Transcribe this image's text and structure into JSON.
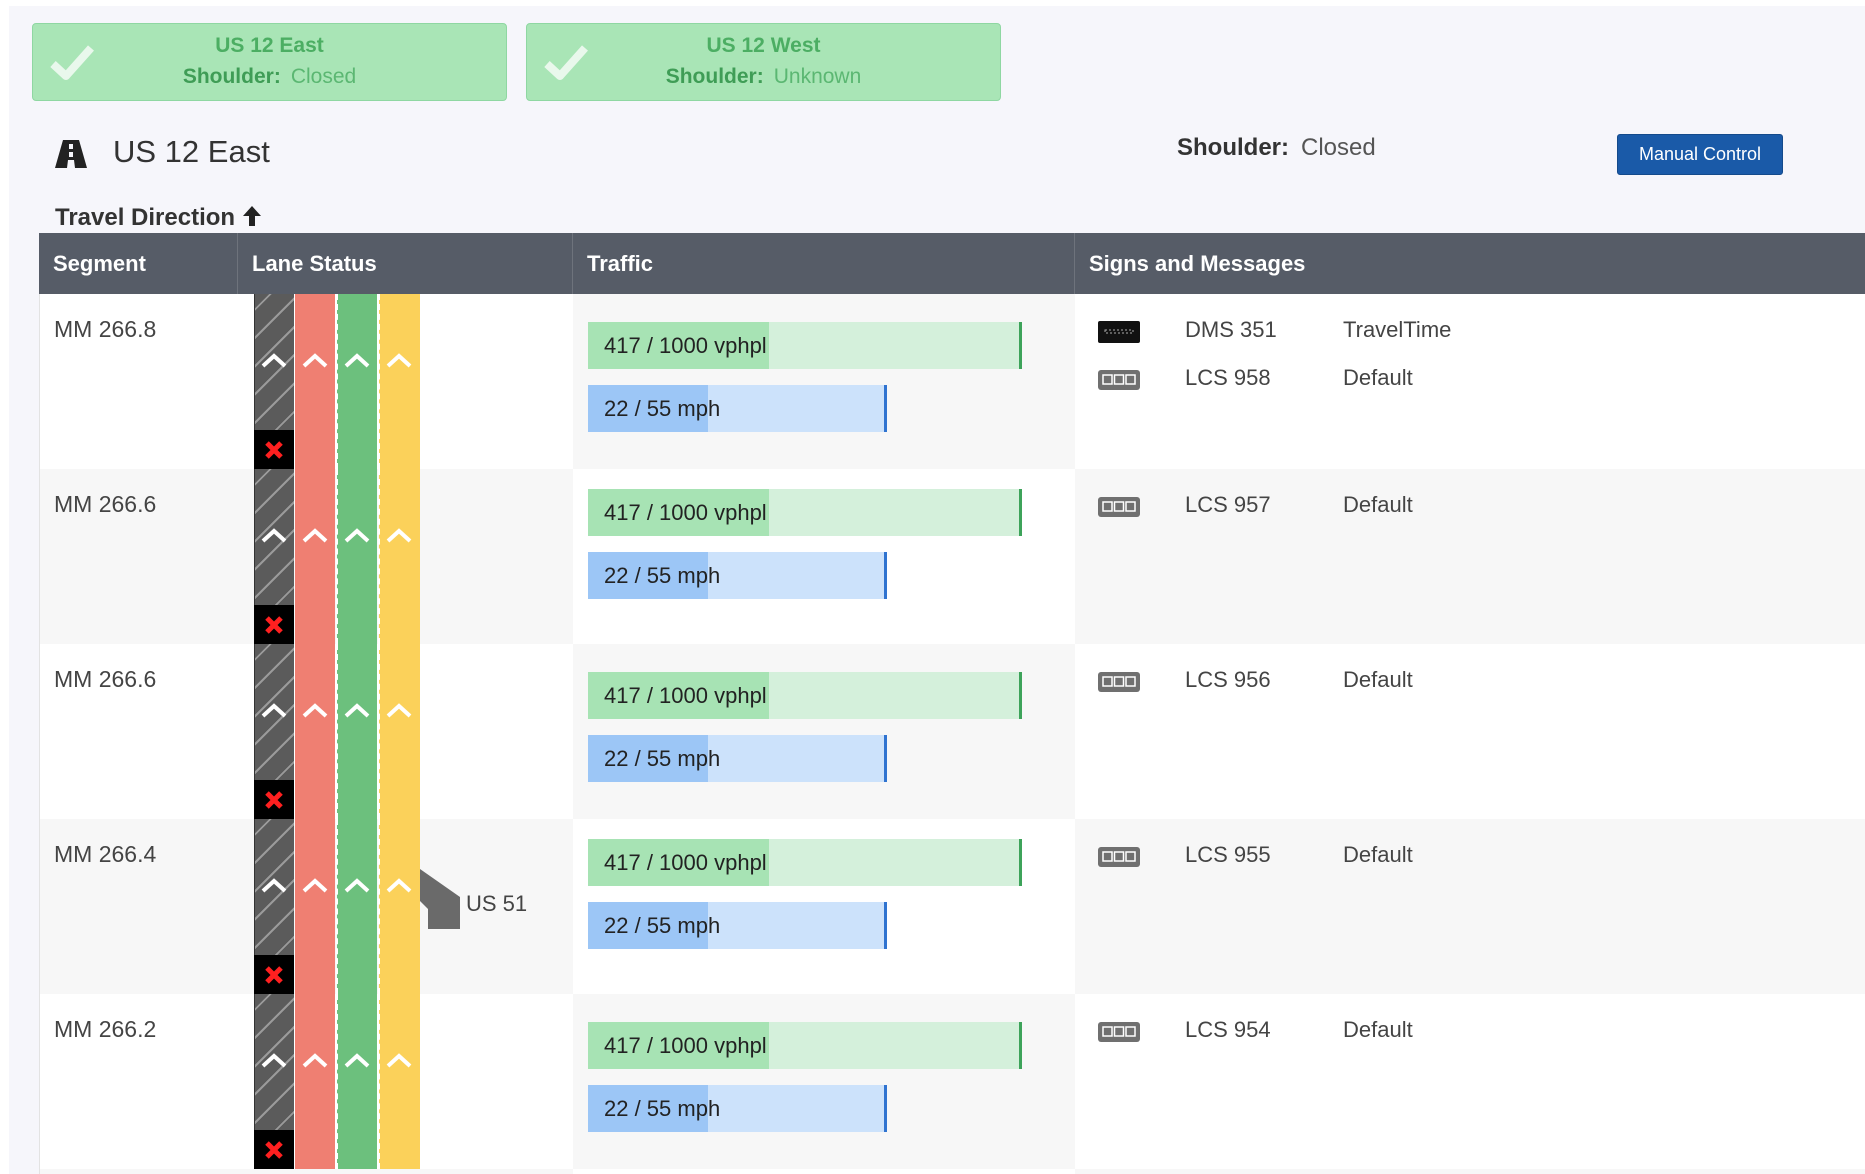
{
  "status_cards": [
    {
      "title": "US 12 East",
      "shoulder_label": "Shoulder:",
      "shoulder_value": "Closed"
    },
    {
      "title": "US 12 West",
      "shoulder_label": "Shoulder:",
      "shoulder_value": "Unknown"
    }
  ],
  "header": {
    "road_name": "US 12 East",
    "shoulder_label": "Shoulder:",
    "shoulder_value": "Closed",
    "manual_button": "Manual Control",
    "travel_direction": "Travel Direction"
  },
  "table": {
    "columns": [
      "Segment",
      "Lane Status",
      "Traffic",
      "Signs and Messages"
    ],
    "rows": [
      {
        "segment": "MM 266.8",
        "volume": "417 / 1000 vphpl",
        "speed": "22 / 55 mph",
        "signs": [
          {
            "type": "dms-icon",
            "id": "DMS 351",
            "message": "TravelTime"
          },
          {
            "type": "lcs-icon",
            "id": "LCS 958",
            "message": "Default"
          }
        ]
      },
      {
        "segment": "MM 266.6",
        "volume": "417 / 1000 vphpl",
        "speed": "22 / 55 mph",
        "signs": [
          {
            "type": "lcs-icon",
            "id": "LCS 957",
            "message": "Default"
          }
        ]
      },
      {
        "segment": "MM 266.6",
        "volume": "417 / 1000 vphpl",
        "speed": "22 / 55 mph",
        "signs": [
          {
            "type": "lcs-icon",
            "id": "LCS 956",
            "message": "Default"
          }
        ]
      },
      {
        "segment": "MM 266.4",
        "exit": "US 51",
        "volume": "417 / 1000 vphpl",
        "speed": "22 / 55 mph",
        "signs": [
          {
            "type": "lcs-icon",
            "id": "LCS 955",
            "message": "Default"
          }
        ]
      },
      {
        "segment": "MM 266.2",
        "volume": "417 / 1000 vphpl",
        "speed": "22 / 55 mph",
        "signs": [
          {
            "type": "lcs-icon",
            "id": "LCS 954",
            "message": "Default"
          }
        ]
      }
    ]
  },
  "colors": {
    "card_bg": "#a9e5b6",
    "header_bg": "#565c67",
    "button_bg": "#1a5aa8",
    "lane_shoulder": "#5b5b5b",
    "lane_1": "#ef7f72",
    "lane_2": "#6cc07d",
    "lane_3": "#fbd15a",
    "volume_fill": "#a7e3b4",
    "speed_fill": "#9cc6f6"
  },
  "icons": [
    "check-icon",
    "road-icon",
    "arrow-up-icon",
    "chevron-up-icon",
    "lane-closed-x-icon",
    "exit-ramp-icon",
    "dms-icon",
    "lcs-icon"
  ]
}
